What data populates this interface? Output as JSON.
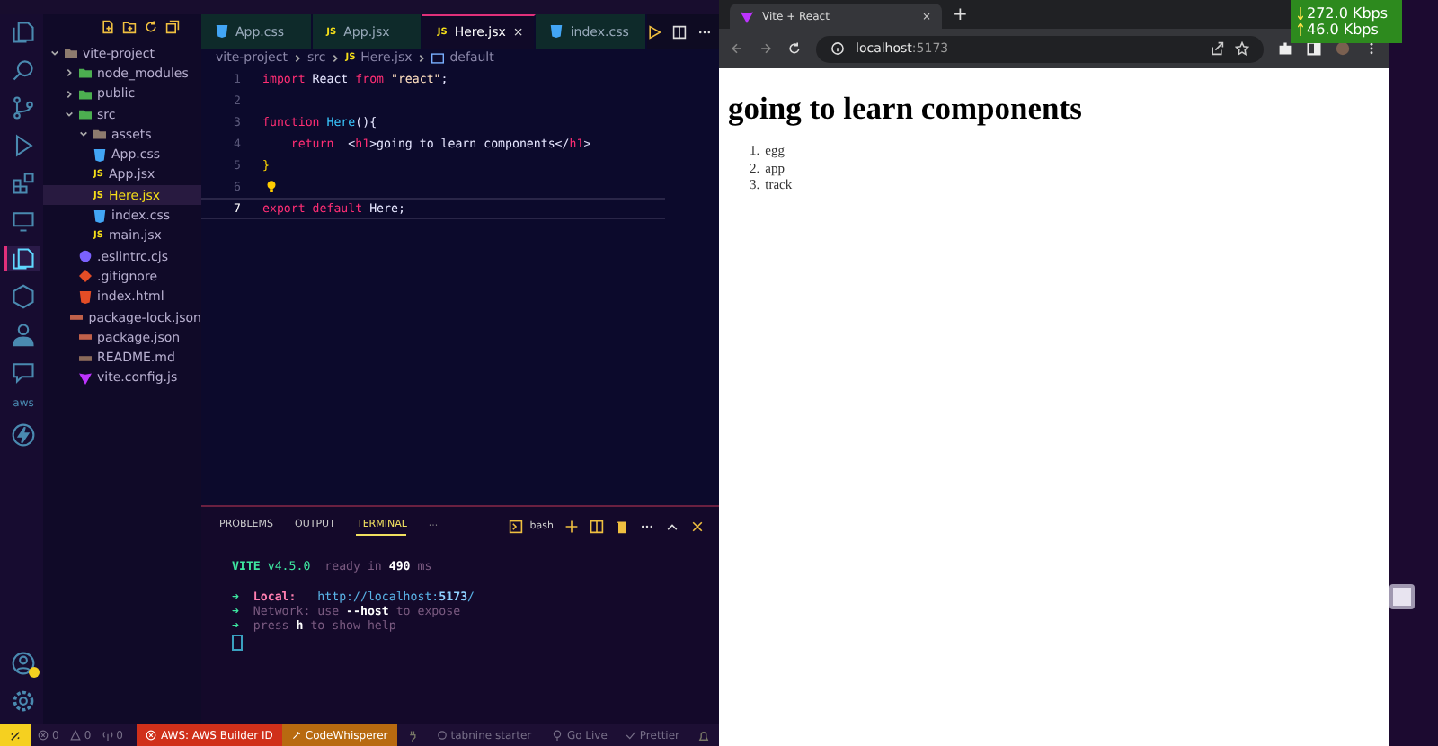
{
  "activity_bar": [
    {
      "kind": "files",
      "selected": false
    },
    {
      "kind": "search",
      "selected": false
    },
    {
      "kind": "branch",
      "selected": false
    },
    {
      "kind": "run",
      "selected": false
    },
    {
      "kind": "extensions",
      "selected": false
    },
    {
      "kind": "monitor",
      "selected": false
    },
    {
      "kind": "copy",
      "selected": true
    },
    {
      "kind": "hexagon",
      "selected": false
    },
    {
      "kind": "person",
      "selected": false
    },
    {
      "kind": "chat",
      "selected": false
    },
    {
      "kind": "aws",
      "label": "aws",
      "selected": false
    },
    {
      "kind": "bolt",
      "selected": false
    }
  ],
  "activity_bottom": [
    {
      "kind": "account",
      "badge": true
    },
    {
      "kind": "gear"
    }
  ],
  "explorer": {
    "tree": [
      {
        "name": "vite-project",
        "kind": "folder",
        "expanded": true,
        "selected": false,
        "children": [
          {
            "name": "node_modules",
            "kind": "folder-green",
            "expanded": false,
            "selected": false
          },
          {
            "name": "public",
            "kind": "folder-green",
            "expanded": false,
            "selected": false
          },
          {
            "name": "src",
            "kind": "folder-green",
            "expanded": true,
            "selected": false,
            "children": [
              {
                "name": "assets",
                "kind": "folder",
                "expanded": true,
                "selected": false
              },
              {
                "name": "App.css",
                "kind": "css",
                "selected": false
              },
              {
                "name": "App.jsx",
                "kind": "js",
                "icon_label": "JS",
                "selected": false
              },
              {
                "name": "Here.jsx",
                "kind": "js",
                "icon_label": "JS",
                "selected": true
              },
              {
                "name": "index.css",
                "kind": "css",
                "selected": false
              },
              {
                "name": "main.jsx",
                "kind": "js",
                "icon_label": "JS",
                "selected": false
              }
            ]
          },
          {
            "name": ".eslintrc.cjs",
            "kind": "eslint",
            "selected": false
          },
          {
            "name": ".gitignore",
            "kind": "git",
            "selected": false
          },
          {
            "name": "index.html",
            "kind": "html",
            "selected": false
          },
          {
            "name": "package-lock.json",
            "kind": "json",
            "selected": false
          },
          {
            "name": "package.json",
            "kind": "json",
            "selected": false
          },
          {
            "name": "README.md",
            "kind": "md",
            "selected": false
          },
          {
            "name": "vite.config.js",
            "kind": "vite",
            "selected": false
          }
        ]
      }
    ]
  },
  "editor_tabs": [
    {
      "label": "App.css",
      "kind": "css",
      "selected": false
    },
    {
      "label": "App.jsx",
      "kind": "js",
      "icon_label": "JS",
      "selected": false
    },
    {
      "label": "Here.jsx",
      "kind": "js",
      "icon_label": "JS",
      "selected": true,
      "close": "×"
    },
    {
      "label": "index.css",
      "kind": "css",
      "selected": false
    }
  ],
  "breadcrumb": [
    {
      "label": "vite-project"
    },
    {
      "label": "src"
    },
    {
      "label": "Here.jsx",
      "kind": "js",
      "icon_label": "JS"
    },
    {
      "label": "default",
      "kind": "symbol"
    }
  ],
  "code": [
    {
      "number": "1",
      "current": false,
      "hint": false,
      "tokens": [
        {
          "kind": "kw",
          "text": "import"
        },
        {
          "kind": "plain",
          "text": " React "
        },
        {
          "kind": "kw",
          "text": "from"
        },
        {
          "kind": "str",
          "text": " \"react\""
        },
        {
          "kind": "plain",
          "text": ";"
        }
      ]
    },
    {
      "number": "2",
      "current": false,
      "hint": false
    },
    {
      "number": "3",
      "current": false,
      "hint": false,
      "tokens": [
        {
          "kind": "kw",
          "text": "function"
        },
        {
          "kind": "fn",
          "text": " Here"
        },
        {
          "kind": "plain",
          "text": "(){"
        }
      ]
    },
    {
      "number": "4",
      "current": false,
      "hint": false,
      "tokens": [
        {
          "kind": "kw",
          "text": "    return"
        },
        {
          "kind": "plain",
          "text": "  <"
        },
        {
          "kind": "tag",
          "text": "h1"
        },
        {
          "kind": "plain",
          "text": ">going to learn components</"
        },
        {
          "kind": "tag",
          "text": "h1"
        },
        {
          "kind": "plain",
          "text": ">"
        }
      ]
    },
    {
      "number": "5",
      "current": false,
      "hint": false,
      "tokens": [
        {
          "kind": "brace",
          "text": "}"
        }
      ]
    },
    {
      "number": "6",
      "current": false,
      "hint": true
    },
    {
      "number": "7",
      "current": true,
      "hint": false,
      "tokens": [
        {
          "kind": "kw",
          "text": "export"
        },
        {
          "kind": "kw",
          "text": " default"
        },
        {
          "kind": "plain",
          "text": " Here;"
        }
      ]
    }
  ],
  "panel": {
    "tabs": [
      {
        "label": "PROBLEMS",
        "selected": false
      },
      {
        "label": "OUTPUT",
        "selected": false
      },
      {
        "label": "TERMINAL",
        "selected": true
      }
    ],
    "more": "···",
    "shell": "bash",
    "terminal": [
      {
        "tokens": [
          {
            "kind": "accent",
            "text": "VITE"
          },
          {
            "kind": "green",
            "text": " v4.5.0"
          },
          {
            "kind": "dim",
            "text": "  ready in "
          },
          {
            "kind": "bold",
            "text": "490"
          },
          {
            "kind": "dim",
            "text": " ms"
          }
        ]
      },
      {
        "gap_before": true,
        "tokens": [
          {
            "kind": "green",
            "text": "➜ "
          },
          {
            "kind": "label",
            "text": " Local:"
          },
          {
            "kind": "link",
            "text": "   http://localhost:"
          },
          {
            "kind": "linkbold",
            "text": "5173"
          },
          {
            "kind": "link",
            "text": "/"
          }
        ]
      },
      {
        "tokens": [
          {
            "kind": "green",
            "text": "➜ "
          },
          {
            "kind": "dim",
            "text": " Network: use "
          },
          {
            "kind": "bold",
            "text": "--host"
          },
          {
            "kind": "dim",
            "text": " to expose"
          }
        ]
      },
      {
        "tokens": [
          {
            "kind": "green",
            "text": "➜ "
          },
          {
            "kind": "dim",
            "text": " press "
          },
          {
            "kind": "bold",
            "text": "h"
          },
          {
            "kind": "dim",
            "text": " to show help"
          }
        ]
      }
    ]
  },
  "status_bar": [
    {
      "kind": "remote"
    },
    {
      "kind": "problems",
      "errors": "0",
      "warnings": "0"
    },
    {
      "kind": "ports",
      "text": "0"
    },
    {
      "kind": "aws",
      "text": "AWS: AWS Builder ID"
    },
    {
      "kind": "whisper",
      "text": "CodeWhisperer"
    },
    {
      "kind": "plug"
    },
    {
      "kind": "tabnine",
      "text": "tabnine starter"
    },
    {
      "kind": "golive",
      "text": "Go Live"
    },
    {
      "kind": "prettier",
      "text": "Prettier"
    },
    {
      "kind": "bell"
    }
  ],
  "browser": {
    "tab": {
      "title": "Vite + React",
      "close": "×"
    },
    "new_tab": "+",
    "url": {
      "host": "localhost",
      "port": ":5173"
    },
    "page": {
      "heading": "going to learn components",
      "items": [
        {
          "number": "1.",
          "text": "egg"
        },
        {
          "number": "2.",
          "text": "app"
        },
        {
          "number": "3.",
          "text": "track"
        }
      ]
    }
  },
  "net_speed": [
    {
      "kind": "down",
      "text": "272.0 Kbps"
    },
    {
      "kind": "up",
      "text": "46.0 Kbps"
    }
  ]
}
